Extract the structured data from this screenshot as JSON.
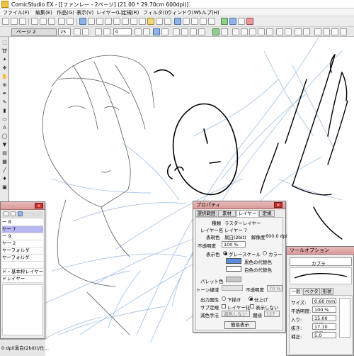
{
  "window": {
    "title": "ComicStudio EX - [[ファンレー - 2ページ] (21.00 * 29.70cm 600dpi)]"
  },
  "menu": [
    "ファイル(F)",
    "編集(E)",
    "作品(G)",
    "表示(V)",
    "レイヤー(L)",
    "定規(R)",
    "フィルタ(I)",
    "ウィンドウ(W)",
    "ヘルプ(H)"
  ],
  "toolbar": {
    "zoom_value": "25.0",
    "angle_value": "0",
    "size_value": "25"
  },
  "page_tab": {
    "label": "ページ 2"
  },
  "layers_panel": {
    "rows": [
      "ー 8",
      "ヤー 7",
      "ー 9",
      "ヤー 2",
      "ヤーフォルダ",
      "ヤーフォルダ",
      "",
      "ド・基本枠レイヤー",
      "ドレイヤー"
    ],
    "status": "0 dpi(黒白(2bit))/仕..."
  },
  "properties": {
    "title": "プロパティ",
    "tabs": [
      "選択範囲",
      "素材",
      "レイヤー",
      "定規"
    ],
    "active_tab": "レイヤー",
    "type_label": "種類",
    "type_value": "ラスターレイヤー",
    "layer_name_label": "レイヤー名",
    "layer_name_value": "レイヤー 7",
    "color_label": "表現色",
    "color_value": "黒白(2bit)",
    "resolution_label": "解像度",
    "resolution_value": "600.0 dpi",
    "opacity_label": "不透明度",
    "opacity_value": "100 %",
    "display_label": "表示色",
    "grayscale": "グレースケール",
    "colormode": "カラー",
    "black_sub": "黒色の代替色",
    "white_sub": "白色の代替色",
    "palette_label": "パレット色",
    "tone_lines_label": "トーン線域",
    "tone_opacity_label": "不透明度",
    "tone_opacity_value": "70 %",
    "output_label": "出力属性",
    "output_draft": "下描き",
    "output_final": "仕上げ",
    "sub_label": "サブ定規",
    "layer_label": "レイヤー化",
    "hide_label": "表示しない",
    "reduce_label": "減色手法",
    "reduce_value": "減色しない",
    "threshold_label": "閾値",
    "threshold_value": "127",
    "simple_button": "簡易表示",
    "colors": {
      "black_swatch": "#5a8de0",
      "white_swatch": "#ffffff"
    }
  },
  "tool_options": {
    "title": "ツールオプション",
    "tool_name": "カブラ",
    "tabs": [
      "一般",
      "ベクター",
      "形状"
    ],
    "rows": [
      {
        "label": "サイズ:",
        "value": "0.60 mm"
      },
      {
        "label": "不透明度:",
        "value": "100 %"
      },
      {
        "label": "入り:",
        "value": "15.00 mm"
      },
      {
        "label": "抜き:",
        "value": "17.10 mm"
      },
      {
        "label": "補正:",
        "value": "5.0"
      }
    ]
  },
  "colors": {
    "title_accent": "#d99a9a",
    "sketch_blue": "#a9c6ea",
    "selected_layer": "#b6b6f0"
  }
}
